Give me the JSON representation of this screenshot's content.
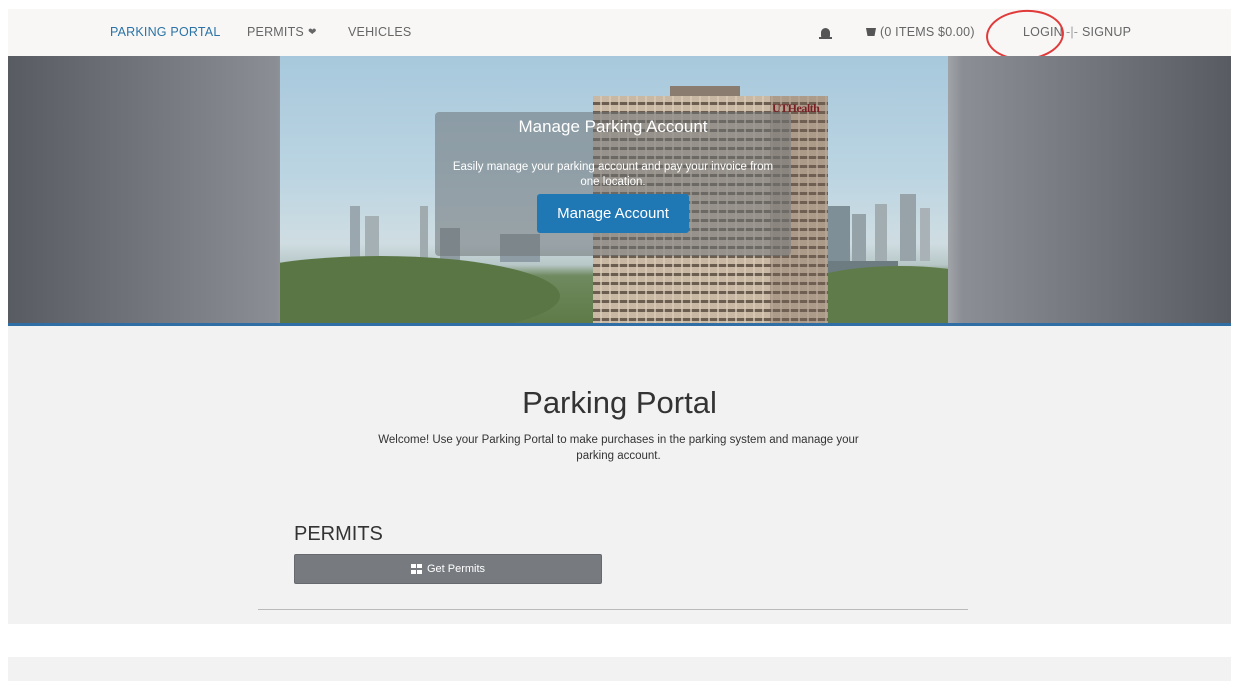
{
  "nav": {
    "brand": "PARKING PORTAL",
    "permits": "PERMITS",
    "vehicles": "VEHICLES",
    "cart": "(0 ITEMS $0.00)",
    "login": "LOGIN",
    "separator": "-|-",
    "signup": "SIGNUP"
  },
  "hero": {
    "title": "Manage Parking Account",
    "text": "Easily manage your parking account and pay your invoice from one location.",
    "button": "Manage Account",
    "building_sign": "UTHealth"
  },
  "main": {
    "title": "Parking Portal",
    "welcome": "Welcome! Use your Parking Portal to make purchases in the parking system and manage your parking account.",
    "permits_heading": "PERMITS",
    "get_permits": "Get Permits"
  },
  "colors": {
    "accent": "#2b73a6",
    "button_primary": "#1f78b4",
    "button_gray": "#777b80",
    "annotation_circle": "#e03a3a"
  }
}
